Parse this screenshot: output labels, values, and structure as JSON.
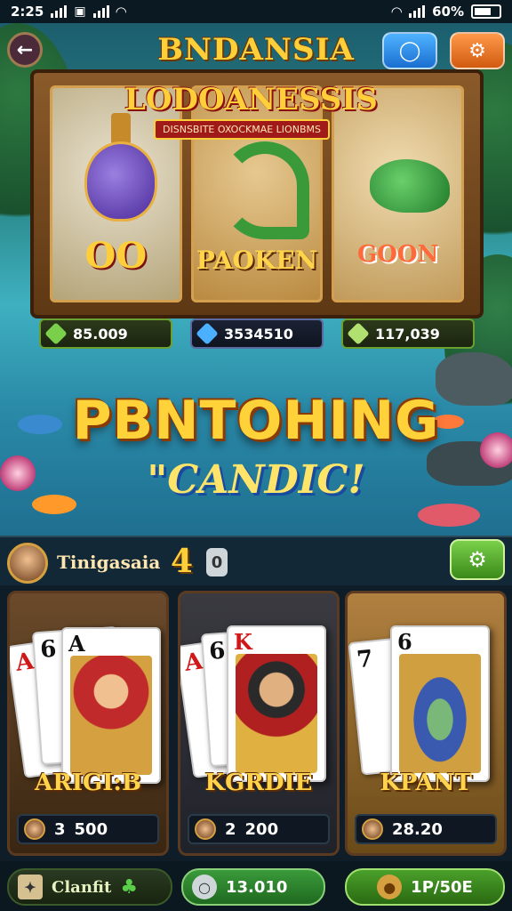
{
  "status": {
    "time": "2:25",
    "battery": "60%"
  },
  "header": {
    "title": "BNDANSIA",
    "back_icon": "arrow-left-icon",
    "chat_icon": "chat-bubble-icon",
    "settings_icon": "gear-icon"
  },
  "slots": {
    "banner_title": "LODOANESSIS",
    "banner_subtitle": "DISNSBITE OXOCKMAE LIONBMS",
    "reels": [
      {
        "icon": "potion-icon",
        "label": "OO"
      },
      {
        "icon": "serpent-icon",
        "label": "PAOKEN"
      },
      {
        "icon": "fish-icon",
        "label": "GOON"
      }
    ],
    "counters": [
      "85.009",
      "3534510",
      "117,039"
    ]
  },
  "headline": {
    "main": "PBNTOHING",
    "sub": "\"CANDIC!"
  },
  "player": {
    "name": "Tinigasaia",
    "level": "4",
    "badge": "0"
  },
  "cards": [
    {
      "name": "ARIGI:B",
      "count": "3",
      "value": "500",
      "ranks": [
        "A",
        "6",
        "A"
      ]
    },
    {
      "name": "KGRDIE",
      "count": "2",
      "value": "200",
      "ranks": [
        "A",
        "6",
        "K"
      ]
    },
    {
      "name": "KPANT",
      "count": "",
      "value": "28.20",
      "ranks": [
        "7",
        "6"
      ]
    }
  ],
  "bottom": {
    "home_label": "Clanfit",
    "search_value": "13.010",
    "coins_value": "1P/50E"
  },
  "colors": {
    "gold": "#ffcf3a",
    "green": "#3a8a1a",
    "wood": "#8a5a2a"
  }
}
